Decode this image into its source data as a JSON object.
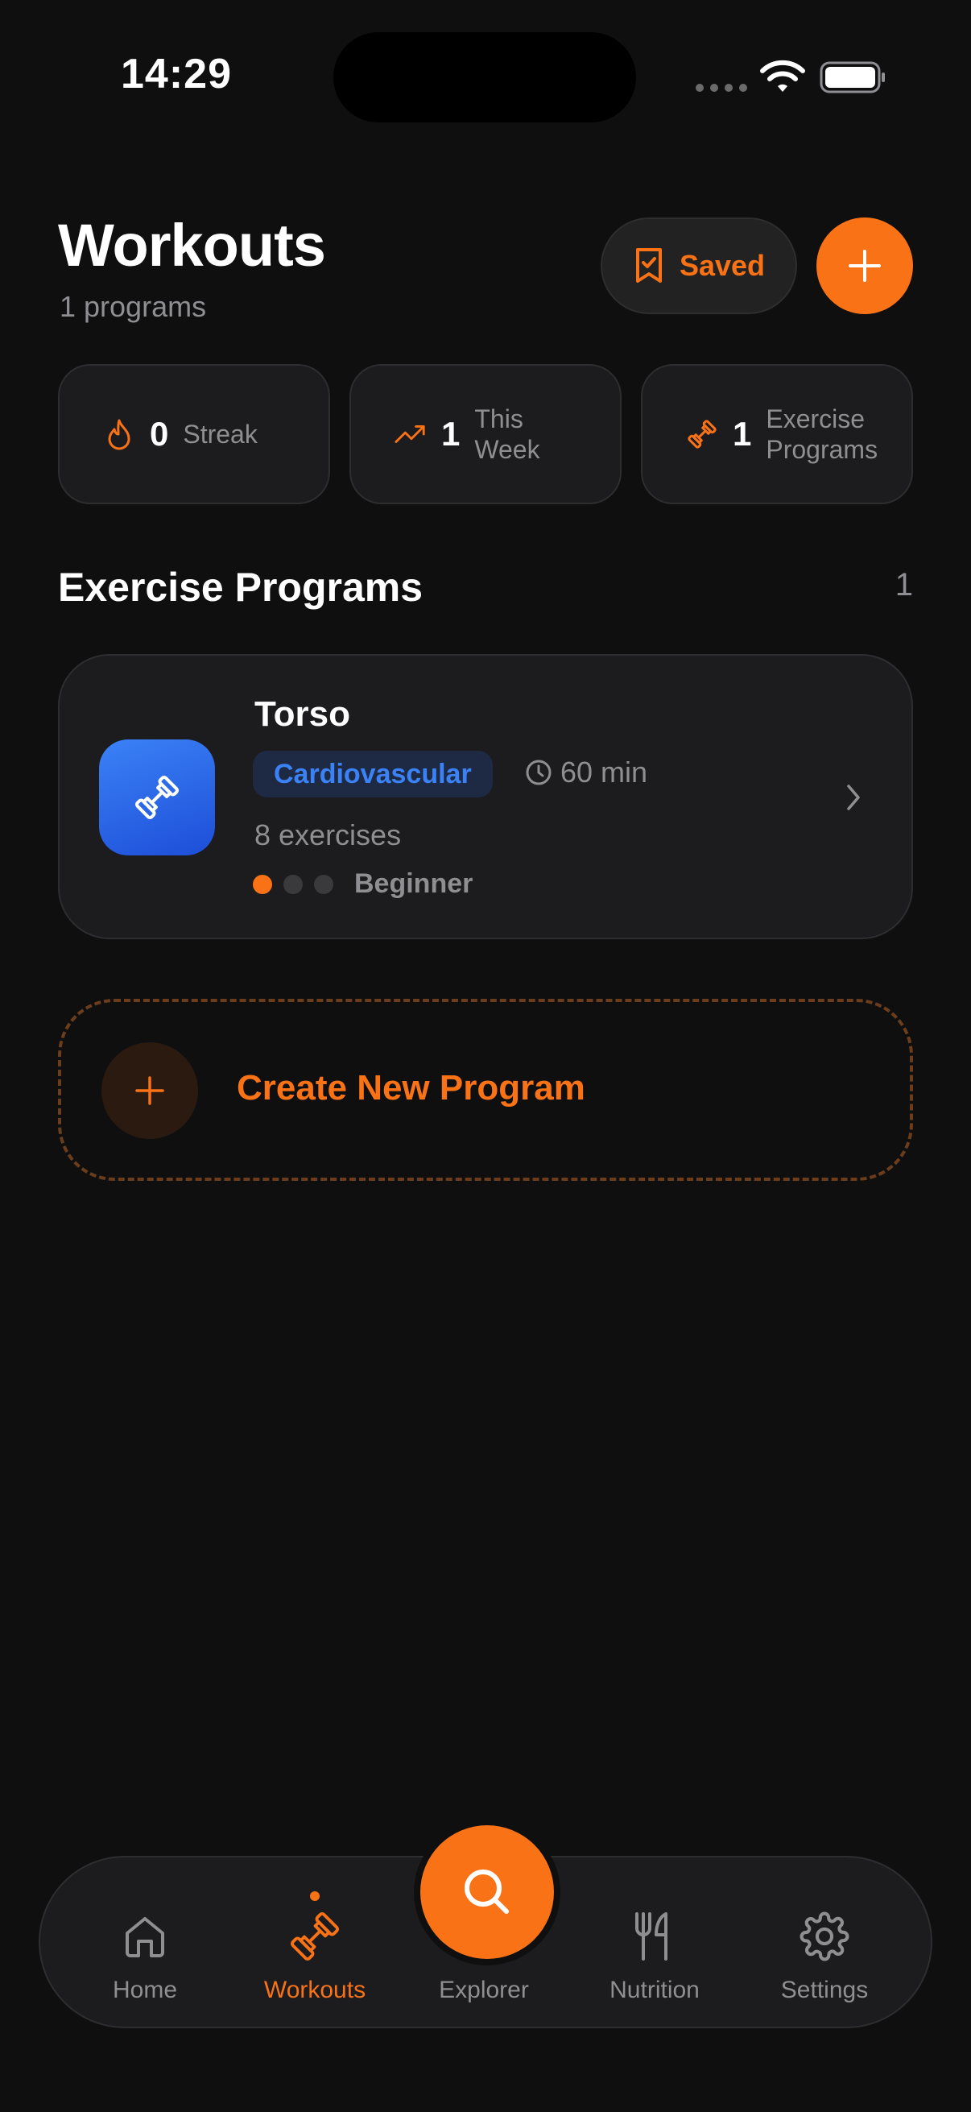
{
  "status": {
    "time": "14:29"
  },
  "header": {
    "title": "Workouts",
    "subtitle": "1 programs",
    "saved_label": "Saved"
  },
  "stats": [
    {
      "value": "0",
      "label": "Streak",
      "icon": "flame-icon"
    },
    {
      "value": "1",
      "label": "This Week",
      "icon": "trend-up-icon"
    },
    {
      "value": "1",
      "label": "Exercise Programs",
      "icon": "dumbbell-icon"
    }
  ],
  "section": {
    "title": "Exercise Programs",
    "count": "1"
  },
  "programs": [
    {
      "name": "Torso",
      "category": "Cardiovascular",
      "duration": "60 min",
      "exercises": "8 exercises",
      "level": "Beginner",
      "level_value": 1,
      "level_max": 3
    }
  ],
  "create": {
    "label": "Create New Program"
  },
  "tabs": [
    {
      "label": "Home",
      "icon": "home-icon"
    },
    {
      "label": "Workouts",
      "icon": "dumbbell-icon",
      "active": true
    },
    {
      "label": "Explorer",
      "icon": "search-icon"
    },
    {
      "label": "Nutrition",
      "icon": "fork-knife-icon"
    },
    {
      "label": "Settings",
      "icon": "gear-icon"
    }
  ],
  "colors": {
    "accent": "#f97316",
    "category": "#3b82f6",
    "background": "#0f0f0f"
  }
}
